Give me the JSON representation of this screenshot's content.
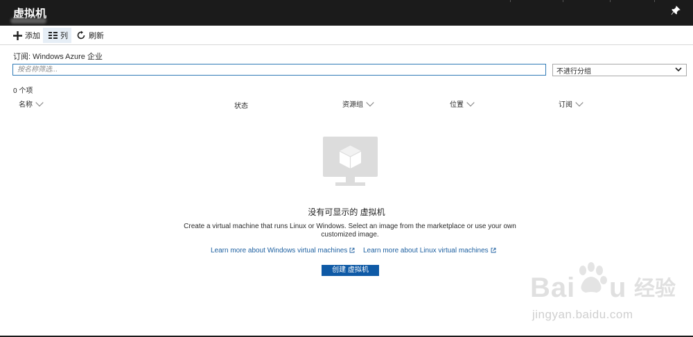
{
  "window": {
    "title": "虚拟机"
  },
  "toolbar": {
    "add_label": "添加",
    "columns_label": "列",
    "refresh_label": "刷新"
  },
  "subscription_line": "订阅: Windows Azure 企业",
  "filter": {
    "placeholder": "按名称筛选..."
  },
  "grouping": {
    "selected": "不进行分组"
  },
  "item_count": "0 个项",
  "columns": [
    "名称",
    "状态",
    "资源组",
    "位置",
    "订阅"
  ],
  "empty_state": {
    "title": "没有可显示的 虚拟机",
    "description": "Create a virtual machine that runs Linux or Windows. Select an image from the marketplace or use your own customized image.",
    "learn_windows": "Learn more about Windows virtual machines",
    "learn_linux": "Learn more about Linux virtual machines",
    "create_label": "创建 虚拟机"
  },
  "watermark": {
    "url": "jingyan.baidu.com"
  },
  "colors": {
    "titlebar": "#1b1b1b",
    "accent": "#0f5aa6",
    "link": "#1c5fa0"
  }
}
